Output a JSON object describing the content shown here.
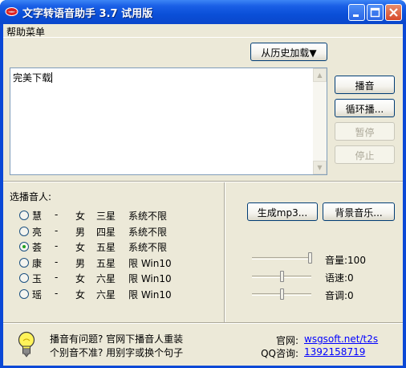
{
  "window": {
    "title": "文字转语音助手 3.7 试用版"
  },
  "menu": {
    "help": "帮助菜单"
  },
  "history_button": "从历史加载▼",
  "text_input": {
    "value": "完美下载"
  },
  "controls": {
    "play": "播音",
    "loop": "循环播...",
    "pause": "暂停",
    "stop": "停止"
  },
  "voices": {
    "label": "选播音人:",
    "selected_index": 2,
    "items": [
      {
        "name": "慧",
        "dash": "-",
        "gender": "女",
        "stars": "三星",
        "platform": "系统不限"
      },
      {
        "name": "亮",
        "dash": "-",
        "gender": "男",
        "stars": "四星",
        "platform": "系统不限"
      },
      {
        "name": "荟",
        "dash": "-",
        "gender": "女",
        "stars": "五星",
        "platform": "系统不限"
      },
      {
        "name": "康",
        "dash": "-",
        "gender": "男",
        "stars": "五星",
        "platform": "限 Win10"
      },
      {
        "name": "玉",
        "dash": "-",
        "gender": "女",
        "stars": "六星",
        "platform": "限 Win10"
      },
      {
        "name": "瑶",
        "dash": "-",
        "gender": "女",
        "stars": "六星",
        "platform": "限 Win10"
      }
    ]
  },
  "output": {
    "mp3": "生成mp3...",
    "bgm": "背景音乐..."
  },
  "sliders": {
    "volume": {
      "label": "音量:100",
      "value": 100,
      "max": 100
    },
    "speed": {
      "label": "语速:0",
      "value": 0,
      "min": -10,
      "max": 10
    },
    "pitch": {
      "label": "音调:0",
      "value": 0,
      "min": -10,
      "max": 10
    }
  },
  "footer": {
    "tip_line1": "播音有问题? 官网下播音人重装",
    "tip_line2": "个别音不准? 用别字或换个句子",
    "website_label": "官网:",
    "website_value": "wsgsoft.net/t2s",
    "qq_label": "QQ咨询:",
    "qq_value": "1392158719"
  },
  "icons": {
    "app": "lips-icon",
    "tip": "lightbulb-icon"
  },
  "colors": {
    "titlebar": "#0a4fd8",
    "face": "#ece9d8",
    "link": "#0000ff"
  }
}
